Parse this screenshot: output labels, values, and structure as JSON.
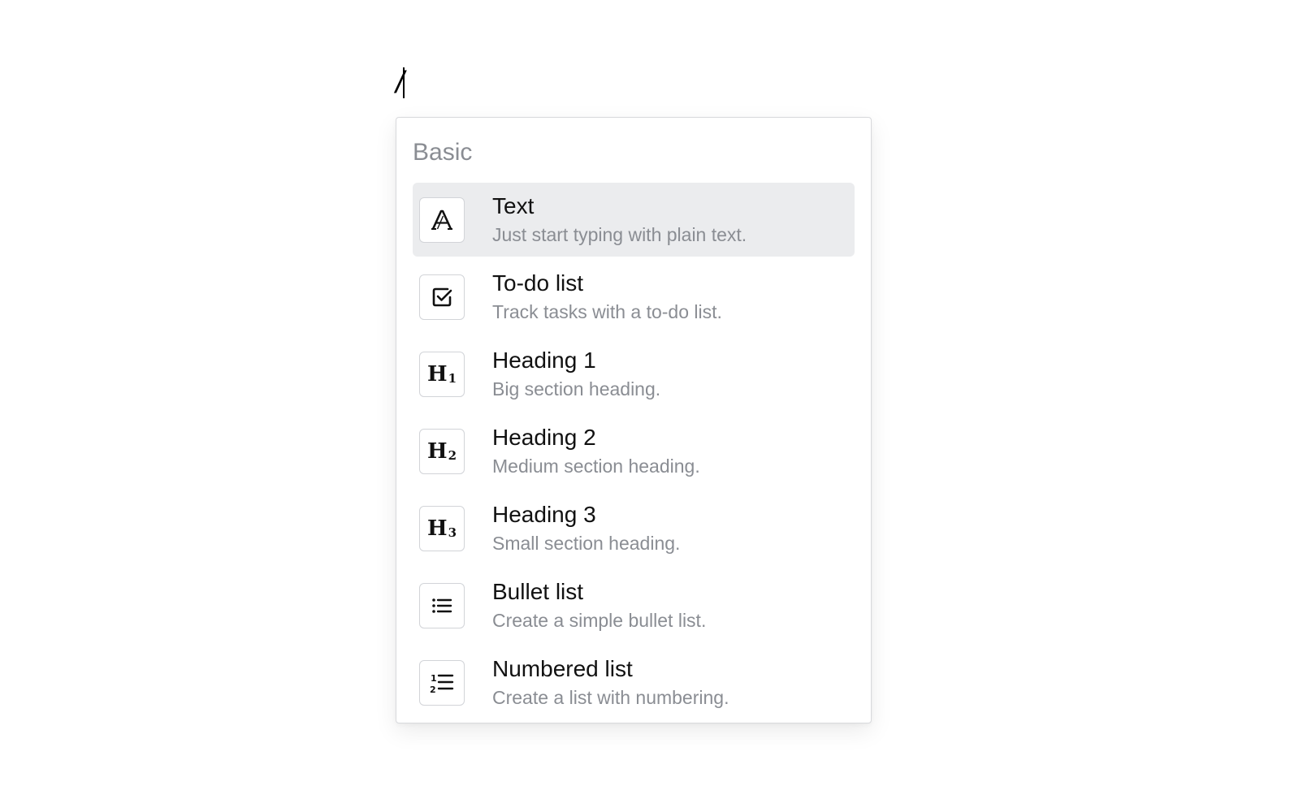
{
  "editor": {
    "typed_text": "/"
  },
  "menu": {
    "group_label": "Basic",
    "items": [
      {
        "title": "Text",
        "description": "Just start typing with plain text.",
        "icon": "text-style-icon",
        "selected": true
      },
      {
        "title": "To-do list",
        "description": "Track tasks with a to-do list.",
        "icon": "checkbox-icon",
        "selected": false
      },
      {
        "title": "Heading 1",
        "description": "Big section heading.",
        "icon": "heading-1-icon",
        "selected": false
      },
      {
        "title": "Heading 2",
        "description": "Medium section heading.",
        "icon": "heading-2-icon",
        "selected": false
      },
      {
        "title": "Heading 3",
        "description": "Small section heading.",
        "icon": "heading-3-icon",
        "selected": false
      },
      {
        "title": "Bullet list",
        "description": "Create a simple bullet list.",
        "icon": "bullet-list-icon",
        "selected": false
      },
      {
        "title": "Numbered list",
        "description": "Create a list with numbering.",
        "icon": "numbered-list-icon",
        "selected": false
      }
    ]
  },
  "colors": {
    "selected_background": "#ebecee",
    "muted_text": "#8a8d93",
    "primary_text": "#111111",
    "border": "#d8d9dc"
  }
}
